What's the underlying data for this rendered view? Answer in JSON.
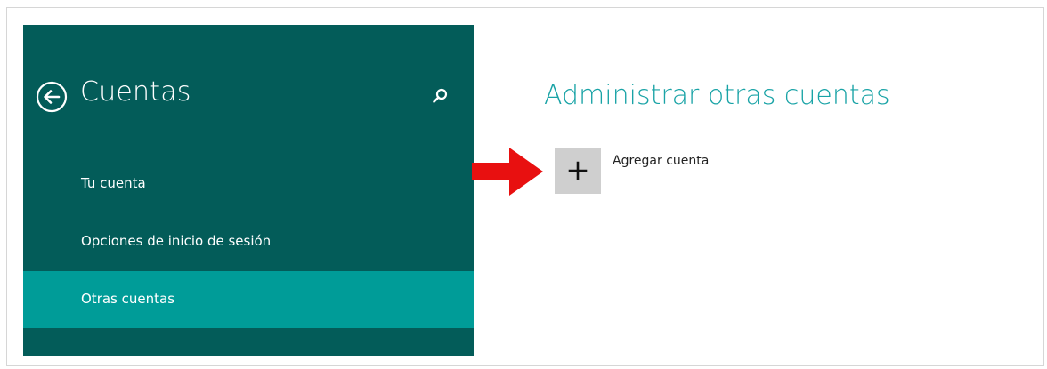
{
  "sidebar": {
    "title": "Cuentas",
    "back_icon": "back-arrow-circle-icon",
    "search_icon": "search-icon",
    "items": [
      {
        "label": "Tu cuenta",
        "selected": false
      },
      {
        "label": "Opciones de inicio de sesión",
        "selected": false
      },
      {
        "label": "Otras cuentas",
        "selected": true
      }
    ]
  },
  "main": {
    "title": "Administrar otras cuentas",
    "add_account": {
      "icon": "plus-icon",
      "label": "Agregar cuenta"
    },
    "annotation_icon": "red-arrow-icon"
  },
  "colors": {
    "sidebar_bg": "#035c59",
    "selected_bg": "#009c98",
    "title_accent": "#19a3a6",
    "annotation_arrow": "#e81010",
    "add_tile_bg": "#cfcfcf"
  }
}
